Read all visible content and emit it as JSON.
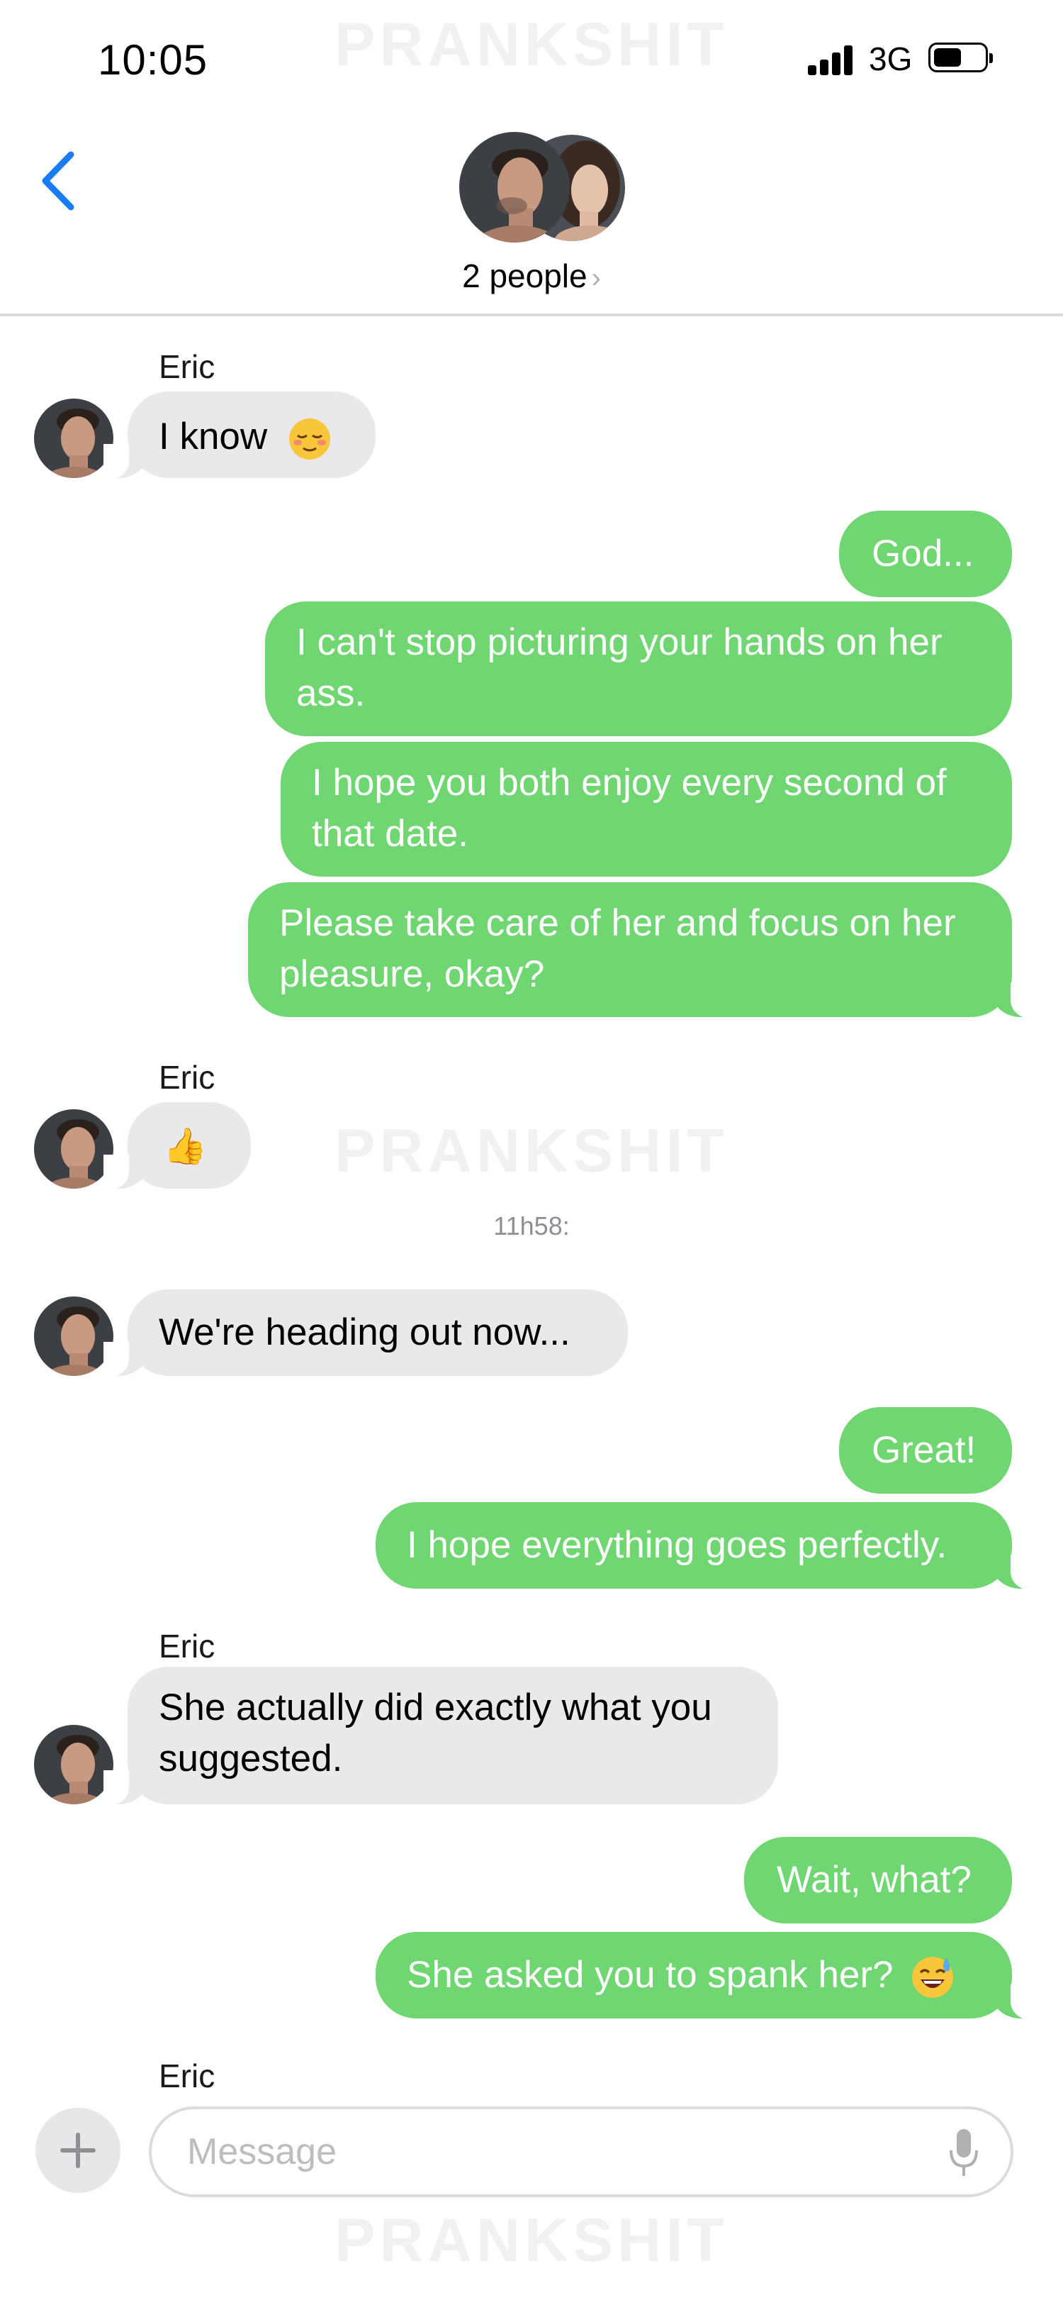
{
  "status_bar": {
    "time": "10:05",
    "network": "3G"
  },
  "watermark": "PRANKSHIT",
  "header": {
    "title": "2 people",
    "chevron": "›"
  },
  "timestamp": "11h58:",
  "messages": [
    {
      "id": "m1",
      "dir": "in",
      "sender": "Eric",
      "text": "I know",
      "emoji": "relieved-face-emoji"
    },
    {
      "id": "m2",
      "dir": "out",
      "text": "God..."
    },
    {
      "id": "m3",
      "dir": "out",
      "text": "I can't stop picturing your hands on her ass."
    },
    {
      "id": "m4",
      "dir": "out",
      "text": "I hope you both enjoy every second of that date."
    },
    {
      "id": "m5",
      "dir": "out",
      "text": "Please take care of her and focus on her pleasure, okay?"
    },
    {
      "id": "m6",
      "dir": "in",
      "sender": "Eric",
      "text": "👍"
    },
    {
      "id": "m7",
      "dir": "in",
      "text": "We're heading out now..."
    },
    {
      "id": "m8",
      "dir": "out",
      "text": "Great!"
    },
    {
      "id": "m9",
      "dir": "out",
      "text": "I hope everything goes perfectly."
    },
    {
      "id": "m10",
      "dir": "in",
      "sender": "Eric",
      "text": "She actually did exactly what you suggested."
    },
    {
      "id": "m11",
      "dir": "out",
      "text": "Wait, what?"
    },
    {
      "id": "m12",
      "dir": "out",
      "text": "She asked you to spank her?",
      "emoji": "sweat-smile-emoji"
    }
  ],
  "typing_sender": "Eric",
  "compose": {
    "placeholder": "Message"
  },
  "colors": {
    "outgoing": "#6fd672",
    "incoming": "#e9e9eb",
    "accent": "#1a7cf5"
  }
}
